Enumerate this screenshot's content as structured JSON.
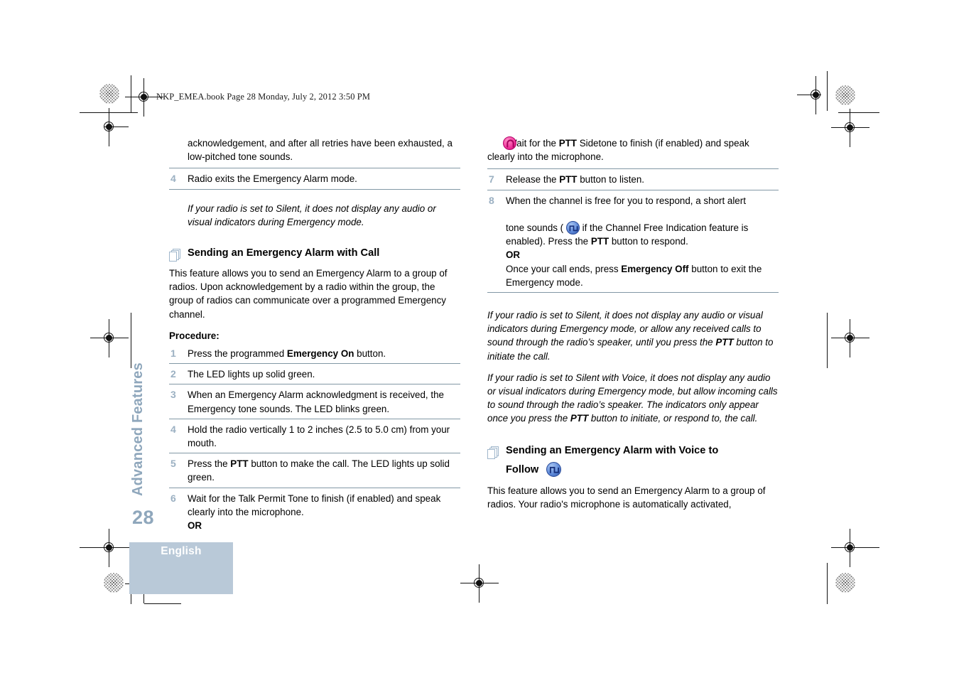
{
  "header": {
    "slug": "NKP_EMEA.book  Page 28  Monday, July 2, 2012  3:50 PM"
  },
  "sidebar": {
    "chapter_title": "Advanced Features",
    "page_number": "28",
    "language_tab": "English",
    "tab_color": "#b9c9d8",
    "chapter_text_color": "#8fa7bc"
  },
  "icons": {
    "pages_icon": "stacked-pages-icon",
    "sidetone_icon": "ptt-sidetone-pink-icon",
    "channel_free_icon": "channel-free-indication-blue-icon",
    "pink": "#f0339a",
    "blue": "#5b87d8",
    "rule_color": "#8298a5",
    "step_number_color": "#9bb0c2"
  },
  "left_column": {
    "continued_paragraph": "acknowledgement, and after all retries have been exhausted, a low-pitched tone sounds.",
    "step4": {
      "num": "4",
      "text": "Radio exits the Emergency Alarm mode."
    },
    "note_silent": "If your radio is set to Silent, it does not display any audio or visual indicators during Emergency mode.",
    "heading": "Sending an Emergency Alarm with Call",
    "intro": "This feature allows you to send an Emergency Alarm to a group of radios. Upon acknowledgement by a radio within the group, the group of radios can communicate over a programmed Emergency channel.",
    "procedure_label": "Procedure:",
    "steps": [
      {
        "num": "1",
        "pre": "Press the programmed ",
        "bold": "Emergency On",
        "post": " button."
      },
      {
        "num": "2",
        "pre": "The LED lights up solid green.",
        "bold": "",
        "post": ""
      },
      {
        "num": "3",
        "pre": "When an Emergency Alarm acknowledgment is received, the Emergency tone sounds. The LED blinks green.",
        "bold": "",
        "post": ""
      },
      {
        "num": "4",
        "pre": "Hold the radio vertically 1 to 2 inches (2.5 to 5.0 cm) from your mouth.",
        "bold": "",
        "post": ""
      },
      {
        "num": "5",
        "pre": "Press the ",
        "bold": "PTT",
        "post": " button to make the call. The LED lights up solid green."
      },
      {
        "num": "6",
        "pre": "Wait for the Talk Permit Tone to finish (if enabled) and speak clearly into the microphone.",
        "bold": "",
        "post": "",
        "or_label": "OR"
      }
    ]
  },
  "right_column": {
    "sidetone_step": {
      "pre": "Wait for the ",
      "bold": "PTT",
      "post": " Sidetone to finish (if enabled) and speak clearly into the microphone."
    },
    "step7": {
      "num": "7",
      "pre": "Release the ",
      "bold": "PTT",
      "post": " button to listen."
    },
    "step8": {
      "num": "8",
      "line1": "When the channel is free for you to respond, a short alert",
      "line2_pre": "tone sounds ( ",
      "line2_post": " if the Channel Free Indication feature is",
      "line3_pre": "enabled). Press the ",
      "line3_bold": "PTT",
      "line3_post": " button to respond.",
      "or_label": "OR",
      "line4_pre": "Once your call ends, press ",
      "line4_bold": "Emergency Off",
      "line4_post": " button to exit the Emergency mode."
    },
    "note_silent": "If your radio is set to Silent, it does not display any audio or visual indicators during Emergency mode, or allow any received calls to sound through the radio's speaker, until you press the PTT button to initiate the call.",
    "note_silent_parts": {
      "a": "If your radio is set to Silent, it does not display any audio or visual indicators during Emergency mode, or allow any received calls to sound through the radio’s speaker, until you press the ",
      "bold": "PTT",
      "b": " button to initiate the call."
    },
    "note_silent_voice_parts": {
      "a": "If your radio is set to Silent with Voice, it does not display any audio or visual indicators during Emergency mode, but allow incoming calls to sound through the radio’s speaker. The indicators only appear once you press the ",
      "bold": "PTT",
      "b": " button to initiate, or respond to, the call."
    },
    "heading_line1": "Sending an Emergency Alarm with Voice to",
    "heading_line2": "Follow",
    "intro": "This feature allows you to send an Emergency Alarm to a group of radios. Your radio's microphone is automatically activated,"
  }
}
